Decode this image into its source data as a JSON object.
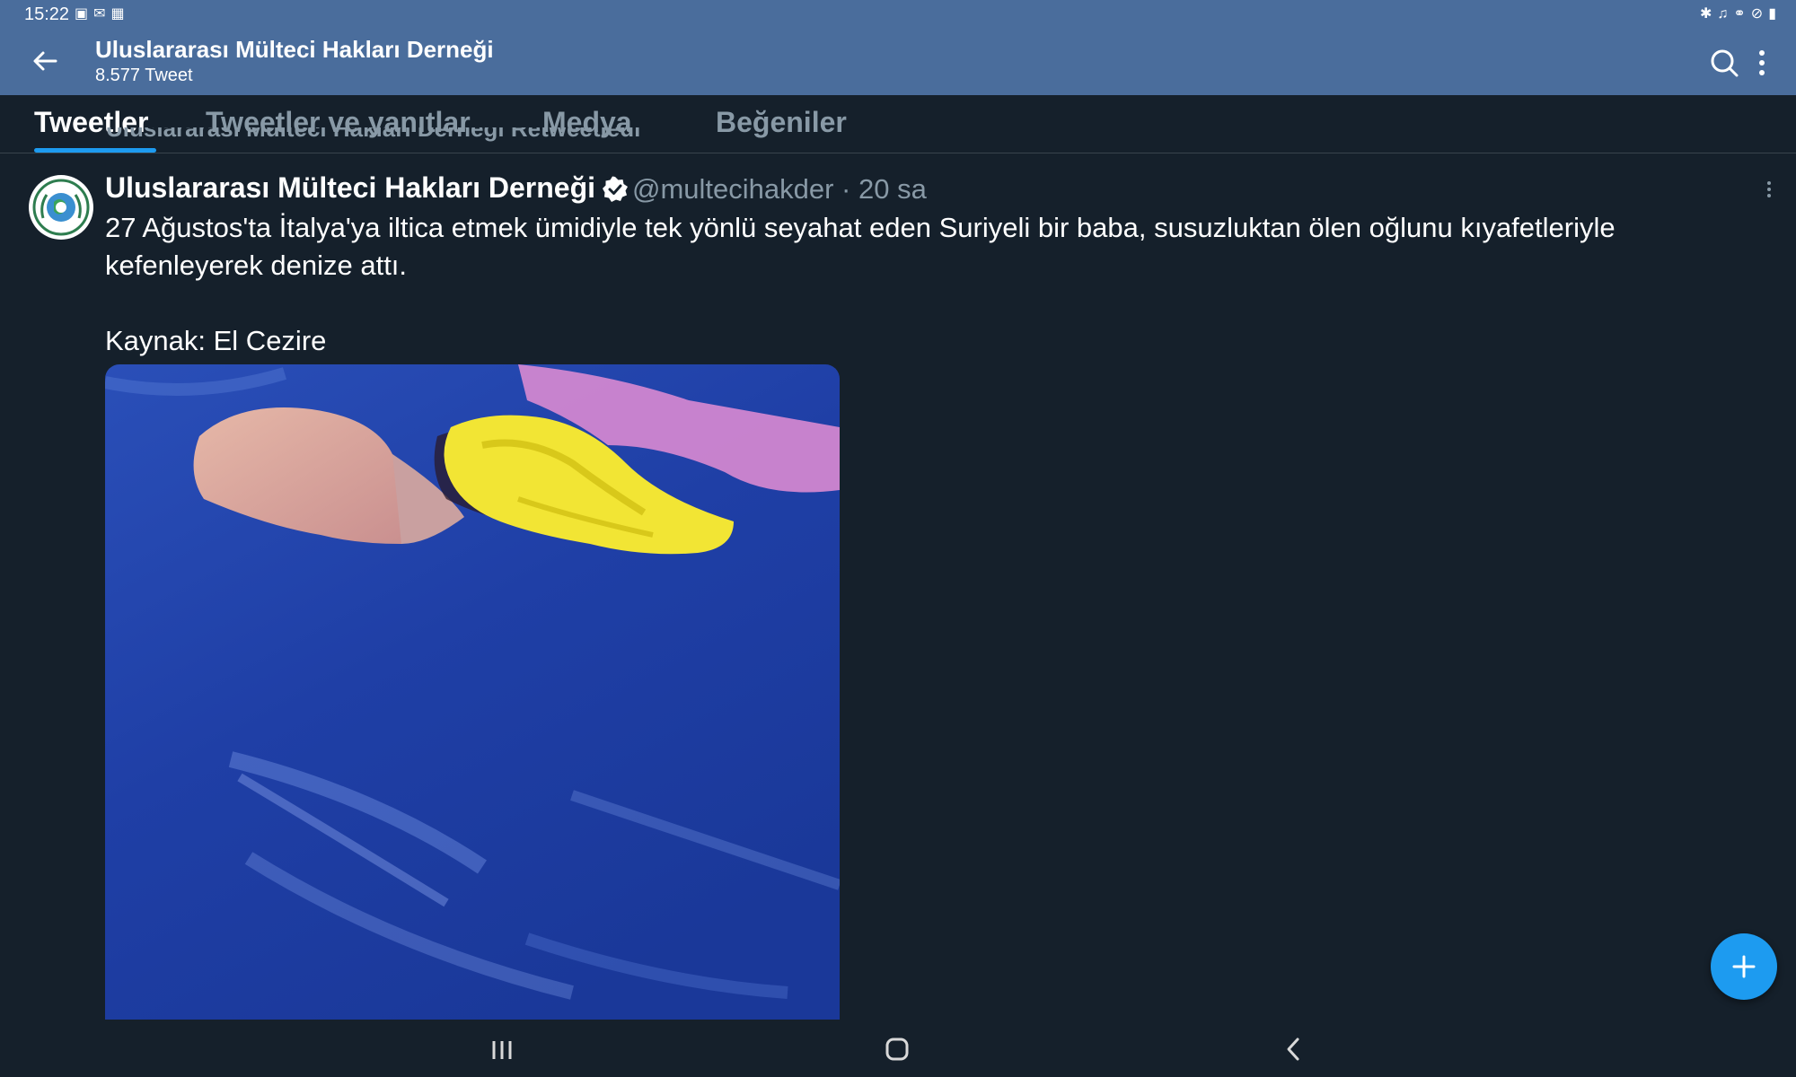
{
  "status_bar": {
    "time": "15:22",
    "left_icons": [
      "image-icon",
      "mail-icon",
      "notification-icon"
    ],
    "right_icons": [
      "bluetooth-icon",
      "mute-icon",
      "wifi-icon",
      "block-icon",
      "battery-icon"
    ]
  },
  "header": {
    "title": "Uluslararası Mülteci Hakları Derneği",
    "subtitle": "8.577 Tweet",
    "back_icon": "arrow-left-icon",
    "search_icon": "search-icon",
    "more_icon": "more-vertical-icon"
  },
  "tabs": [
    {
      "label": "Tweetler",
      "active": true
    },
    {
      "label": "Tweetler ve yanıtlar",
      "active": false
    },
    {
      "label": "Medya",
      "active": false
    },
    {
      "label": "Beğeniler",
      "active": false
    }
  ],
  "retweet_line": "Uluslararası Mülteci Hakları Derneği Retweetledi",
  "tweet": {
    "author_name": "Uluslararası Mülteci Hakları Derneği",
    "handle": "@multecihakder · 20 sa",
    "text": "27 Ağustos'ta İtalya'ya iltica etmek ümidiyle tek yönlü seyahat eden Suriyeli bir baba, susuzluktan ölen oğlunu kıyafetleriyle\nkefenleyerek denize attı.\n\nKaynak: El Cezire",
    "verified": true
  },
  "colors": {
    "header_bg": "#4a6d9c",
    "page_bg": "#15202b",
    "accent": "#1d9bf0",
    "muted_text": "#8899a6"
  },
  "nav": {
    "recent_icon": "recent-apps-icon",
    "home_icon": "home-icon",
    "back_icon": "back-chevron-icon"
  }
}
